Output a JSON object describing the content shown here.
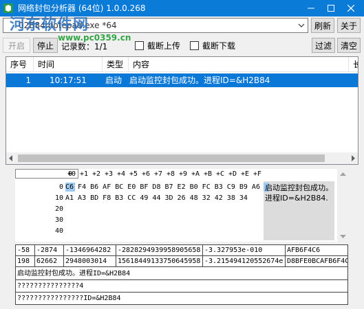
{
  "window": {
    "title": "网络封包分析器 (64位) 1.0.0.268",
    "icon": "app-icon",
    "controls": [
      "minimize-icon",
      "maximize-icon",
      "close-icon"
    ]
  },
  "watermark": {
    "line1": "河东软件网",
    "line2": "www.pc0359.cn"
  },
  "toolbar": {
    "process_value": "02B84:notepad.exe *64",
    "refresh_label": "刷新",
    "about_label": "关于",
    "start_label": "开启",
    "stop_label": "停止",
    "record_count": "记录数：1/1",
    "block_upload_label": "截断上传",
    "block_download_label": "截断下载",
    "filter_label": "过滤",
    "clear_label": "清空"
  },
  "list": {
    "columns": [
      "序号",
      "时间",
      "类型",
      "内容",
      "长"
    ],
    "rows": [
      {
        "index": "1",
        "time": "10:17:51",
        "type": "启动",
        "content": "启动监控封包成功。进程ID=&H2B84"
      }
    ]
  },
  "hex": {
    "ruler_mark": "0",
    "column_headers": [
      "+0",
      "+1",
      "+2",
      "+3",
      "+4",
      "+5",
      "+6",
      "+7",
      "+8",
      "+9",
      "+A",
      "+B",
      "+C",
      "+D",
      "+E",
      "+F"
    ],
    "rows": [
      {
        "offset": "0",
        "bytes": "C6 F4 B6 AF BC E0 BF D8 B7 E2 B0 FC B3 C9 B9 A6"
      },
      {
        "offset": "10",
        "bytes": "A1 A3 BD F8 B3 CC 49 44 3D 26 48 32 42 38 34"
      },
      {
        "offset": "20",
        "bytes": ""
      },
      {
        "offset": "30",
        "bytes": ""
      },
      {
        "offset": "40",
        "bytes": ""
      }
    ],
    "text": "启动监控封包成功。进程ID=&H2B84."
  },
  "conversion": {
    "row1": [
      "-58",
      "-2874",
      "-1346964282",
      "-2828294939958905658",
      "-3.327953e-010",
      "AFB6F4C6"
    ],
    "row2": [
      "198",
      "62662",
      "2948003014",
      "15618449133750645958",
      "-3.215494120552674e",
      "D8BFE0BCAFB6F4C"
    ],
    "line3": "启动监控封包成功。进程ID=&H2B84",
    "line4": "???????????????4",
    "line5": "????????????????ID=&H2B84"
  }
}
